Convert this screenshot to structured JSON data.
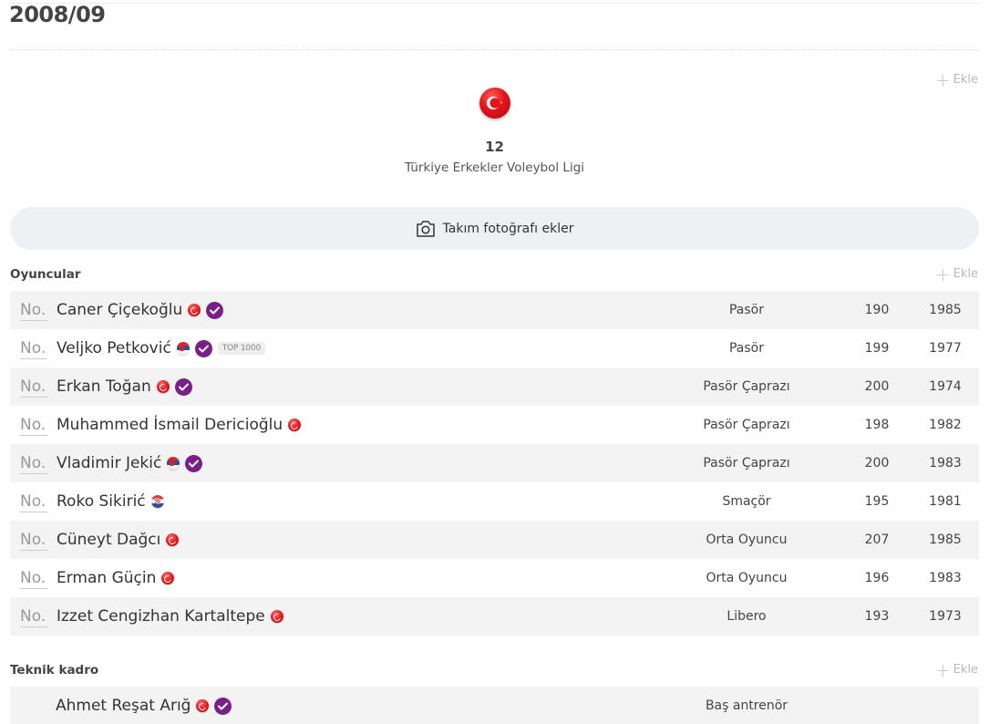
{
  "season": {
    "title": "2008/09"
  },
  "actions": {
    "add_label": "Ekle",
    "photo_label": "Takım fotoğrafı ekler"
  },
  "league": {
    "count": "12",
    "name": "Türkiye Erkekler Voleybol Ligi",
    "flag_icon": "turkey-flag-icon"
  },
  "sections": {
    "players": "Oyuncular",
    "staff": "Teknik kadro"
  },
  "player_no_label": "No.",
  "players": [
    {
      "name": "Caner Çiçekoğlu",
      "flag": "tr",
      "verified": true,
      "badge": "",
      "position": "Pasör",
      "height": "190",
      "year": "1985"
    },
    {
      "name": "Veljko Petković",
      "flag": "rs",
      "verified": true,
      "badge": "TOP 1000",
      "position": "Pasör",
      "height": "199",
      "year": "1977"
    },
    {
      "name": "Erkan Toğan",
      "flag": "tr",
      "verified": true,
      "badge": "",
      "position": "Pasör Çaprazı",
      "height": "200",
      "year": "1974"
    },
    {
      "name": "Muhammed İsmail Dericioğlu",
      "flag": "tr",
      "verified": false,
      "badge": "",
      "position": "Pasör Çaprazı",
      "height": "198",
      "year": "1982"
    },
    {
      "name": "Vladimir Jekić",
      "flag": "rs",
      "verified": true,
      "badge": "",
      "position": "Pasör Çaprazı",
      "height": "200",
      "year": "1983"
    },
    {
      "name": "Roko Sikirić",
      "flag": "hr",
      "verified": false,
      "badge": "",
      "position": "Smaçör",
      "height": "195",
      "year": "1981"
    },
    {
      "name": "Cüneyt Dağcı",
      "flag": "tr",
      "verified": false,
      "badge": "",
      "position": "Orta Oyuncu",
      "height": "207",
      "year": "1985"
    },
    {
      "name": "Erman Güçin",
      "flag": "tr",
      "verified": false,
      "badge": "",
      "position": "Orta Oyuncu",
      "height": "196",
      "year": "1983"
    },
    {
      "name": "Izzet Cengizhan Kartaltepe",
      "flag": "tr",
      "verified": false,
      "badge": "",
      "position": "Libero",
      "height": "193",
      "year": "1973"
    }
  ],
  "staff": [
    {
      "name": "Ahmet Reşat Arığ",
      "flag": "tr",
      "verified": true,
      "role": "Baş antrenör"
    }
  ],
  "colors": {
    "verified": "#7b1f88",
    "row_alt": "#f3f3f3",
    "photo_button": "#eef0f4"
  }
}
